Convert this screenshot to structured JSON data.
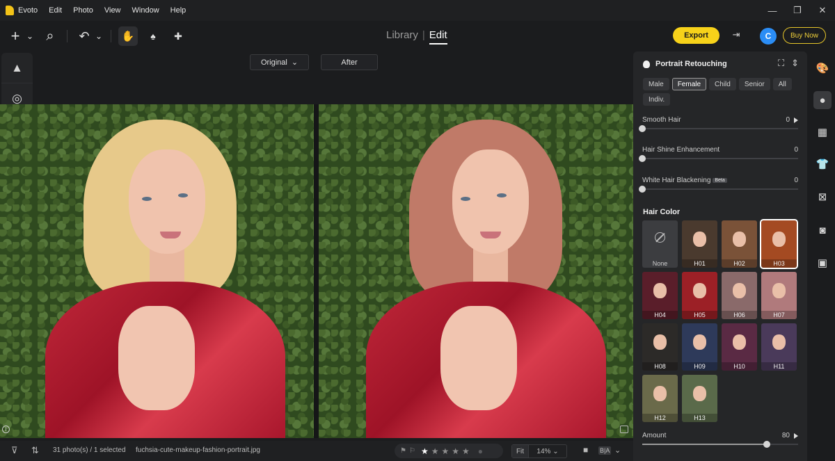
{
  "app": {
    "name": "Evoto"
  },
  "menu": [
    "Evoto",
    "Edit",
    "Photo",
    "View",
    "Window",
    "Help"
  ],
  "window_controls": {
    "minimize": "—",
    "restore": "❐",
    "close": "✕"
  },
  "toolbar": {
    "icons": {
      "add": "+",
      "add_caret": "⌄",
      "search": "⌕",
      "undo": "↶",
      "undo_caret": "⌄",
      "hand": "✋",
      "brush": "♠",
      "bandage": "✚"
    },
    "tab_library": "Library",
    "tab_edit": "Edit",
    "export_label": "Export",
    "export_icon": "⇥",
    "avatar_letter": "C",
    "buy_now_label": "Buy Now"
  },
  "left_rail": {
    "icons": [
      "▲",
      "◎",
      "⟲"
    ]
  },
  "compare": {
    "original_label": "Original",
    "original_caret": "⌄",
    "after_label": "After"
  },
  "canvas": {
    "hair_colors": {
      "left": "#e7c98a",
      "right": "#c07a68"
    },
    "info_glyph": "i"
  },
  "bottom": {
    "filter_icon": "⊽",
    "sort_icon": "⇅",
    "selection": "31 photo(s) / 1 selected",
    "filename": "fuchsia-cute-makeup-fashion-portrait.jpg",
    "rating": {
      "flags": [
        "⚑",
        "⚐"
      ],
      "stars": 5,
      "filled": 1,
      "dot": "●"
    },
    "fit_label": "Fit",
    "zoom_label": "14%",
    "zoom_caret": "⌄",
    "view_icons": [
      "■",
      "B|A",
      "⌄"
    ]
  },
  "panel": {
    "title": "Portrait Retouching",
    "header_icons": [
      "⛶",
      "⇕"
    ],
    "chips": [
      {
        "label": "Male",
        "selected": false
      },
      {
        "label": "Female",
        "selected": true
      },
      {
        "label": "Child",
        "selected": false
      },
      {
        "label": "Senior",
        "selected": false
      },
      {
        "label": "All",
        "selected": false
      },
      {
        "label": "Indiv.",
        "selected": false
      }
    ],
    "sliders": {
      "smooth_hair": {
        "label": "Smooth Hair",
        "value": "0",
        "fraction": 0
      },
      "hair_shine": {
        "label": "Hair Shine Enhancement",
        "value": "0",
        "fraction": 0
      },
      "white_hair": {
        "label": "White Hair Blackening",
        "badge": "Beta",
        "value": "0",
        "fraction": 0
      },
      "amount": {
        "label": "Amount",
        "value": "80",
        "fraction": 0.8
      }
    },
    "hair_color_title": "Hair Color",
    "swatches": [
      {
        "label": "None",
        "color": "#3c3d40"
      },
      {
        "label": "H01",
        "color": "#4a3a2e"
      },
      {
        "label": "H02",
        "color": "#7a5238"
      },
      {
        "label": "H03",
        "color": "#a44a22"
      },
      {
        "label": "H04",
        "color": "#5a1e2a"
      },
      {
        "label": "H05",
        "color": "#9c2026"
      },
      {
        "label": "H06",
        "color": "#8a6a6a"
      },
      {
        "label": "H07",
        "color": "#b07a7c"
      },
      {
        "label": "H08",
        "color": "#2c2a28"
      },
      {
        "label": "H09",
        "color": "#2e3a5a"
      },
      {
        "label": "H10",
        "color": "#5a2a44"
      },
      {
        "label": "H11",
        "color": "#4a3a5a"
      },
      {
        "label": "H12",
        "color": "#6a6a4a"
      },
      {
        "label": "H13",
        "color": "#5a6a4a"
      }
    ],
    "selected_swatch": "H03"
  },
  "right_rail": {
    "icons": [
      "🎨",
      "●",
      "▦",
      "👕",
      "⊠",
      "◙",
      "▣"
    ]
  }
}
